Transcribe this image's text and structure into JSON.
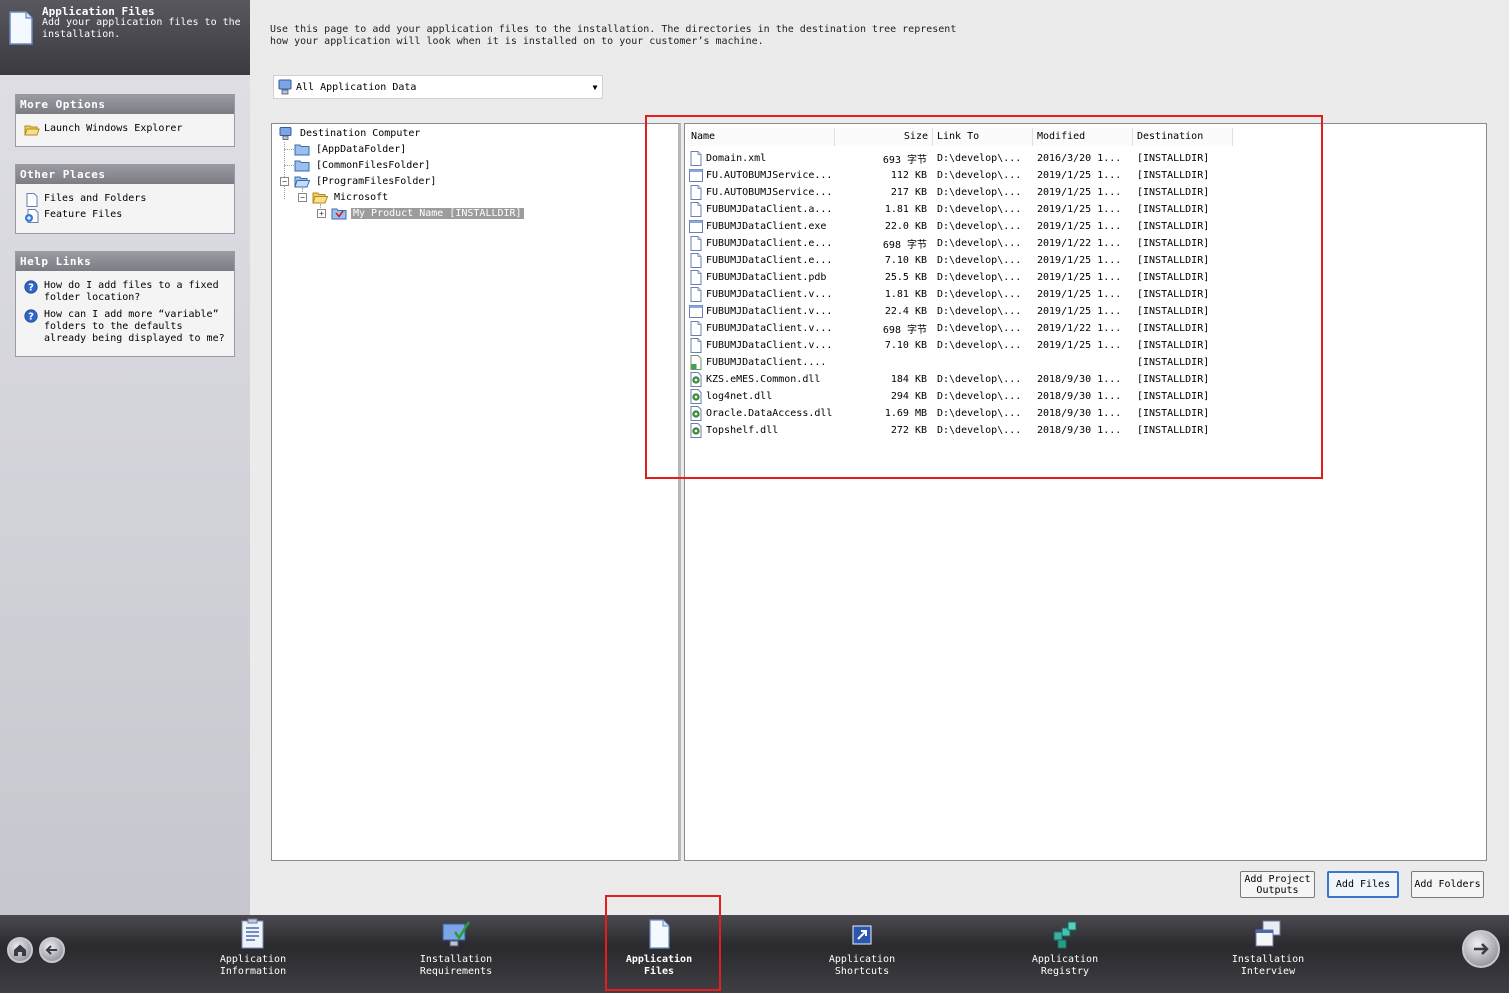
{
  "header": {
    "title": "Application Files",
    "subtitle": "Add your application files to the installation."
  },
  "sidebar": {
    "more_options": {
      "title": "More Options",
      "items": [
        {
          "label": "Launch Windows Explorer",
          "icon": "folder-open-icon"
        }
      ]
    },
    "other_places": {
      "title": "Other Places",
      "items": [
        {
          "label": "Files and Folders",
          "icon": "document-icon"
        },
        {
          "label": "Feature Files",
          "icon": "feature-files-icon"
        }
      ]
    },
    "help_links": {
      "title": "Help Links",
      "items": [
        {
          "label": "How do I add files to a fixed folder location?",
          "icon": "help-icon"
        },
        {
          "label": "How can I add more “variable” folders to the defaults already being displayed to me?",
          "icon": "help-icon"
        }
      ]
    }
  },
  "intro": "Use this page to add your application files to the installation. The directories in the destination tree represent how your application will look when it is installed on to your customer’s machine.",
  "view_select": {
    "value": "All Application Data"
  },
  "tree": {
    "root": "Destination Computer",
    "nodes": [
      {
        "label": "[AppDataFolder]"
      },
      {
        "label": "[CommonFilesFolder]"
      },
      {
        "label": "[ProgramFilesFolder]"
      },
      {
        "label": "Microsoft"
      },
      {
        "label": "My Product Name [INSTALLDIR]"
      }
    ]
  },
  "file_list": {
    "columns": [
      "Name",
      "Size",
      "Link To",
      "Modified",
      "Destination"
    ],
    "rows": [
      {
        "name": "Domain.xml",
        "size": "693 字节",
        "link": "D:\\develop\\...",
        "modified": "2016/3/20 1...",
        "dest": "[INSTALLDIR]",
        "icon": "text-file-icon"
      },
      {
        "name": "FU.AUTOBUMJService...",
        "size": "112 KB",
        "link": "D:\\develop\\...",
        "modified": "2019/1/25 1...",
        "dest": "[INSTALLDIR]",
        "icon": "exe-file-icon"
      },
      {
        "name": "FU.AUTOBUMJService...",
        "size": "217 KB",
        "link": "D:\\develop\\...",
        "modified": "2019/1/25 1...",
        "dest": "[INSTALLDIR]",
        "icon": "text-file-icon"
      },
      {
        "name": "FUBUMJDataClient.a...",
        "size": "1.81 KB",
        "link": "D:\\develop\\...",
        "modified": "2019/1/25 1...",
        "dest": "[INSTALLDIR]",
        "icon": "text-file-icon"
      },
      {
        "name": "FUBUMJDataClient.exe",
        "size": "22.0 KB",
        "link": "D:\\develop\\...",
        "modified": "2019/1/25 1...",
        "dest": "[INSTALLDIR]",
        "icon": "exe-file-icon"
      },
      {
        "name": "FUBUMJDataClient.e...",
        "size": "698 字节",
        "link": "D:\\develop\\...",
        "modified": "2019/1/22 1...",
        "dest": "[INSTALLDIR]",
        "icon": "text-file-icon"
      },
      {
        "name": "FUBUMJDataClient.e...",
        "size": "7.10 KB",
        "link": "D:\\develop\\...",
        "modified": "2019/1/25 1...",
        "dest": "[INSTALLDIR]",
        "icon": "text-file-icon"
      },
      {
        "name": "FUBUMJDataClient.pdb",
        "size": "25.5 KB",
        "link": "D:\\develop\\...",
        "modified": "2019/1/25 1...",
        "dest": "[INSTALLDIR]",
        "icon": "text-file-icon"
      },
      {
        "name": "FUBUMJDataClient.v...",
        "size": "1.81 KB",
        "link": "D:\\develop\\...",
        "modified": "2019/1/25 1...",
        "dest": "[INSTALLDIR]",
        "icon": "text-file-icon"
      },
      {
        "name": "FUBUMJDataClient.v...",
        "size": "22.4 KB",
        "link": "D:\\develop\\...",
        "modified": "2019/1/25 1...",
        "dest": "[INSTALLDIR]",
        "icon": "exe-file-icon"
      },
      {
        "name": "FUBUMJDataClient.v...",
        "size": "698 字节",
        "link": "D:\\develop\\...",
        "modified": "2019/1/22 1...",
        "dest": "[INSTALLDIR]",
        "icon": "text-file-icon"
      },
      {
        "name": "FUBUMJDataClient.v...",
        "size": "7.10 KB",
        "link": "D:\\develop\\...",
        "modified": "2019/1/25 1...",
        "dest": "[INSTALLDIR]",
        "icon": "text-file-icon"
      },
      {
        "name": "FUBUMJDataClient....",
        "size": "",
        "link": "",
        "modified": "",
        "dest": "[INSTALLDIR]",
        "icon": "shortcut-file-icon"
      },
      {
        "name": "KZS.eMES.Common.dll",
        "size": "184 KB",
        "link": "D:\\develop\\...",
        "modified": "2018/9/30 1...",
        "dest": "[INSTALLDIR]",
        "icon": "dll-file-icon"
      },
      {
        "name": "log4net.dll",
        "size": "294 KB",
        "link": "D:\\develop\\...",
        "modified": "2018/9/30 1...",
        "dest": "[INSTALLDIR]",
        "icon": "dll-file-icon"
      },
      {
        "name": "Oracle.DataAccess.dll",
        "size": "1.69 MB",
        "link": "D:\\develop\\...",
        "modified": "2018/9/30 1...",
        "dest": "[INSTALLDIR]",
        "icon": "dll-file-icon"
      },
      {
        "name": "Topshelf.dll",
        "size": "272 KB",
        "link": "D:\\develop\\...",
        "modified": "2018/9/30 1...",
        "dest": "[INSTALLDIR]",
        "icon": "dll-file-icon"
      }
    ]
  },
  "buttons": {
    "add_project_outputs": "Add Project Outputs",
    "add_files": "Add Files",
    "add_folders": "Add Folders"
  },
  "nav": {
    "items": [
      {
        "label": "Application\nInformation",
        "icon": "application-information-icon"
      },
      {
        "label": "Installation\nRequirements",
        "icon": "installation-requirements-icon"
      },
      {
        "label": "Application\nFiles",
        "icon": "application-files-icon"
      },
      {
        "label": "Application\nShortcuts",
        "icon": "application-shortcuts-icon"
      },
      {
        "label": "Application\nRegistry",
        "icon": "application-registry-icon"
      },
      {
        "label": "Installation\nInterview",
        "icon": "installation-interview-icon"
      }
    ],
    "current": "Application Files"
  },
  "colors": {
    "highlight": "#e41e1e",
    "selection": "#9c9c9c",
    "nav_bg": "#2a2a2e"
  }
}
